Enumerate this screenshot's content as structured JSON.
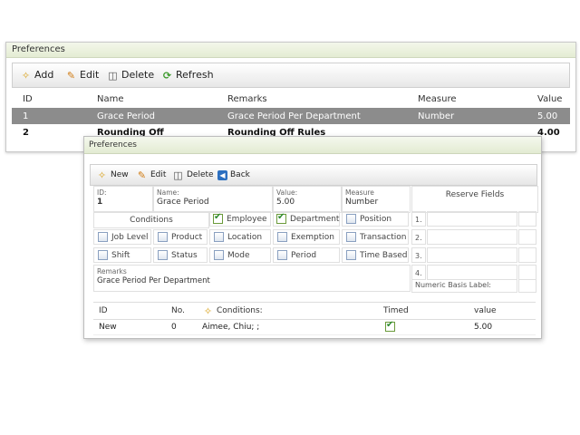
{
  "outer": {
    "title": "Preferences",
    "toolbar": {
      "add": "Add",
      "edit": "Edit",
      "delete": "Delete",
      "refresh": "Refresh"
    },
    "columns": [
      "ID",
      "Name",
      "Remarks",
      "Measure",
      "Value"
    ],
    "rows": [
      {
        "id": "1",
        "name": "Grace Period",
        "remarks": "Grace Period Per Department",
        "measure": "Number",
        "value": "5.00"
      },
      {
        "id": "2",
        "name": "Rounding Off",
        "remarks": "Rounding Off Rules",
        "measure": "",
        "value": "4.00"
      }
    ]
  },
  "dialog": {
    "title": "Preferences",
    "toolbar": {
      "new": "New",
      "edit": "Edit",
      "delete": "Delete",
      "back": "Back"
    },
    "fields": {
      "id_label": "ID:",
      "id_value": "1",
      "name_label": "Name:",
      "name_value": "Grace Period",
      "value_label": "Value:",
      "value_value": "5.00",
      "measure_label": "Measure",
      "measure_value": "Number",
      "reserve_label": "Reserve Fields",
      "conditions_label": "Conditions",
      "remarks_label": "Remarks",
      "remarks_value": "Grace Period Per Department",
      "numeric_basis_label": "Numeric Basis Label:"
    },
    "checkboxes": {
      "employee": "Employee",
      "department": "Department",
      "position": "Position",
      "job_level": "Job Level",
      "product": "Product",
      "location": "Location",
      "exemption": "Exemption",
      "transaction": "Transaction",
      "shift": "Shift",
      "status": "Status",
      "mode": "Mode",
      "period": "Period",
      "time_based": "Time Based"
    },
    "reserve_numbers": [
      "1.",
      "2.",
      "3.",
      "4."
    ],
    "table": {
      "headers": {
        "id": "ID",
        "no": "No.",
        "conditions": "Conditions:",
        "timed": "Timed",
        "value": "value"
      },
      "rows": [
        {
          "id": "New",
          "no": "0",
          "conditions": "Aimee, Chiu; ;",
          "timed": true,
          "value": "5.00"
        }
      ]
    }
  }
}
